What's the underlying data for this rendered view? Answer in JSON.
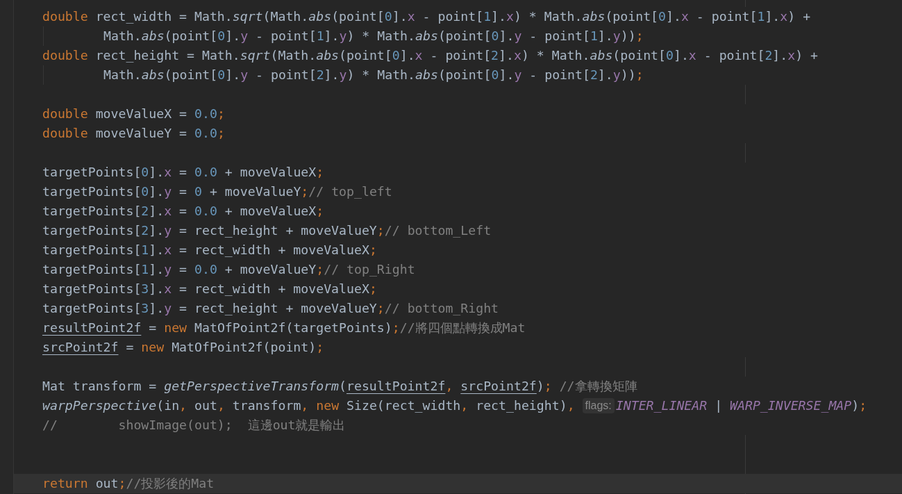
{
  "editor": {
    "lines": [
      {
        "kind": "code",
        "current": false,
        "tokens": [
          {
            "kind": "kw",
            "text": "double"
          },
          {
            "kind": "id",
            "text": " rect_width = Math."
          },
          {
            "kind": "fn",
            "text": "sqrt"
          },
          {
            "kind": "id",
            "text": "(Math."
          },
          {
            "kind": "fn",
            "text": "abs"
          },
          {
            "kind": "id",
            "text": "(point["
          },
          {
            "kind": "num",
            "text": "0"
          },
          {
            "kind": "id",
            "text": "]."
          },
          {
            "kind": "field",
            "text": "x"
          },
          {
            "kind": "id",
            "text": " - point["
          },
          {
            "kind": "num",
            "text": "1"
          },
          {
            "kind": "id",
            "text": "]."
          },
          {
            "kind": "field",
            "text": "x"
          },
          {
            "kind": "id",
            "text": ") * Math."
          },
          {
            "kind": "fn",
            "text": "abs"
          },
          {
            "kind": "id",
            "text": "(point["
          },
          {
            "kind": "num",
            "text": "0"
          },
          {
            "kind": "id",
            "text": "]."
          },
          {
            "kind": "field",
            "text": "x"
          },
          {
            "kind": "id",
            "text": " - point["
          },
          {
            "kind": "num",
            "text": "1"
          },
          {
            "kind": "id",
            "text": "]."
          },
          {
            "kind": "field",
            "text": "x"
          },
          {
            "kind": "id",
            "text": ") +"
          }
        ]
      },
      {
        "kind": "continuation",
        "current": false,
        "tokens": [
          {
            "kind": "id",
            "text": "Math."
          },
          {
            "kind": "fn",
            "text": "abs"
          },
          {
            "kind": "id",
            "text": "(point["
          },
          {
            "kind": "num",
            "text": "0"
          },
          {
            "kind": "id",
            "text": "]."
          },
          {
            "kind": "field",
            "text": "y"
          },
          {
            "kind": "id",
            "text": " - point["
          },
          {
            "kind": "num",
            "text": "1"
          },
          {
            "kind": "id",
            "text": "]."
          },
          {
            "kind": "field",
            "text": "y"
          },
          {
            "kind": "id",
            "text": ") * Math."
          },
          {
            "kind": "fn",
            "text": "abs"
          },
          {
            "kind": "id",
            "text": "(point["
          },
          {
            "kind": "num",
            "text": "0"
          },
          {
            "kind": "id",
            "text": "]."
          },
          {
            "kind": "field",
            "text": "y"
          },
          {
            "kind": "id",
            "text": " - point["
          },
          {
            "kind": "num",
            "text": "1"
          },
          {
            "kind": "id",
            "text": "]."
          },
          {
            "kind": "field",
            "text": "y"
          },
          {
            "kind": "id",
            "text": "))"
          },
          {
            "kind": "punct",
            "text": ";"
          }
        ]
      },
      {
        "kind": "code",
        "current": false,
        "tokens": [
          {
            "kind": "kw",
            "text": "double"
          },
          {
            "kind": "id",
            "text": " rect_height = Math."
          },
          {
            "kind": "fn",
            "text": "sqrt"
          },
          {
            "kind": "id",
            "text": "(Math."
          },
          {
            "kind": "fn",
            "text": "abs"
          },
          {
            "kind": "id",
            "text": "(point["
          },
          {
            "kind": "num",
            "text": "0"
          },
          {
            "kind": "id",
            "text": "]."
          },
          {
            "kind": "field",
            "text": "x"
          },
          {
            "kind": "id",
            "text": " - point["
          },
          {
            "kind": "num",
            "text": "2"
          },
          {
            "kind": "id",
            "text": "]."
          },
          {
            "kind": "field",
            "text": "x"
          },
          {
            "kind": "id",
            "text": ") * Math."
          },
          {
            "kind": "fn",
            "text": "abs"
          },
          {
            "kind": "id",
            "text": "(point["
          },
          {
            "kind": "num",
            "text": "0"
          },
          {
            "kind": "id",
            "text": "]."
          },
          {
            "kind": "field",
            "text": "x"
          },
          {
            "kind": "id",
            "text": " - point["
          },
          {
            "kind": "num",
            "text": "2"
          },
          {
            "kind": "id",
            "text": "]."
          },
          {
            "kind": "field",
            "text": "x"
          },
          {
            "kind": "id",
            "text": ") +"
          }
        ]
      },
      {
        "kind": "continuation",
        "current": false,
        "tokens": [
          {
            "kind": "id",
            "text": "Math."
          },
          {
            "kind": "fn",
            "text": "abs"
          },
          {
            "kind": "id",
            "text": "(point["
          },
          {
            "kind": "num",
            "text": "0"
          },
          {
            "kind": "id",
            "text": "]."
          },
          {
            "kind": "field",
            "text": "y"
          },
          {
            "kind": "id",
            "text": " - point["
          },
          {
            "kind": "num",
            "text": "2"
          },
          {
            "kind": "id",
            "text": "]."
          },
          {
            "kind": "field",
            "text": "y"
          },
          {
            "kind": "id",
            "text": ") * Math."
          },
          {
            "kind": "fn",
            "text": "abs"
          },
          {
            "kind": "id",
            "text": "(point["
          },
          {
            "kind": "num",
            "text": "0"
          },
          {
            "kind": "id",
            "text": "]."
          },
          {
            "kind": "field",
            "text": "y"
          },
          {
            "kind": "id",
            "text": " - point["
          },
          {
            "kind": "num",
            "text": "2"
          },
          {
            "kind": "id",
            "text": "]."
          },
          {
            "kind": "field",
            "text": "y"
          },
          {
            "kind": "id",
            "text": "))"
          },
          {
            "kind": "punct",
            "text": ";"
          }
        ]
      },
      {
        "kind": "blank",
        "current": false
      },
      {
        "kind": "code",
        "current": false,
        "tokens": [
          {
            "kind": "kw",
            "text": "double"
          },
          {
            "kind": "id",
            "text": " moveValueX = "
          },
          {
            "kind": "num",
            "text": "0.0"
          },
          {
            "kind": "punct",
            "text": ";"
          }
        ]
      },
      {
        "kind": "code",
        "current": false,
        "tokens": [
          {
            "kind": "kw",
            "text": "double"
          },
          {
            "kind": "id",
            "text": " moveValueY = "
          },
          {
            "kind": "num",
            "text": "0.0"
          },
          {
            "kind": "punct",
            "text": ";"
          }
        ]
      },
      {
        "kind": "blank",
        "current": false
      },
      {
        "kind": "code",
        "current": false,
        "tokens": [
          {
            "kind": "id",
            "text": "targetPoints["
          },
          {
            "kind": "num",
            "text": "0"
          },
          {
            "kind": "id",
            "text": "]."
          },
          {
            "kind": "field",
            "text": "x"
          },
          {
            "kind": "id",
            "text": " = "
          },
          {
            "kind": "num",
            "text": "0.0"
          },
          {
            "kind": "id",
            "text": " + moveValueX"
          },
          {
            "kind": "punct",
            "text": ";"
          }
        ]
      },
      {
        "kind": "code",
        "current": false,
        "tokens": [
          {
            "kind": "id",
            "text": "targetPoints["
          },
          {
            "kind": "num",
            "text": "0"
          },
          {
            "kind": "id",
            "text": "]."
          },
          {
            "kind": "field",
            "text": "y"
          },
          {
            "kind": "id",
            "text": " = "
          },
          {
            "kind": "num",
            "text": "0"
          },
          {
            "kind": "id",
            "text": " + moveValueY"
          },
          {
            "kind": "punct",
            "text": ";"
          },
          {
            "kind": "com",
            "text": "// top_left"
          }
        ]
      },
      {
        "kind": "code",
        "current": false,
        "tokens": [
          {
            "kind": "id",
            "text": "targetPoints["
          },
          {
            "kind": "num",
            "text": "2"
          },
          {
            "kind": "id",
            "text": "]."
          },
          {
            "kind": "field",
            "text": "x"
          },
          {
            "kind": "id",
            "text": " = "
          },
          {
            "kind": "num",
            "text": "0.0"
          },
          {
            "kind": "id",
            "text": " + moveValueX"
          },
          {
            "kind": "punct",
            "text": ";"
          }
        ]
      },
      {
        "kind": "code",
        "current": false,
        "tokens": [
          {
            "kind": "id",
            "text": "targetPoints["
          },
          {
            "kind": "num",
            "text": "2"
          },
          {
            "kind": "id",
            "text": "]."
          },
          {
            "kind": "field",
            "text": "y"
          },
          {
            "kind": "id",
            "text": " = rect_height + moveValueY"
          },
          {
            "kind": "punct",
            "text": ";"
          },
          {
            "kind": "com",
            "text": "// bottom_Left"
          }
        ]
      },
      {
        "kind": "code",
        "current": false,
        "tokens": [
          {
            "kind": "id",
            "text": "targetPoints["
          },
          {
            "kind": "num",
            "text": "1"
          },
          {
            "kind": "id",
            "text": "]."
          },
          {
            "kind": "field",
            "text": "x"
          },
          {
            "kind": "id",
            "text": " = rect_width + moveValueX"
          },
          {
            "kind": "punct",
            "text": ";"
          }
        ]
      },
      {
        "kind": "code",
        "current": false,
        "tokens": [
          {
            "kind": "id",
            "text": "targetPoints["
          },
          {
            "kind": "num",
            "text": "1"
          },
          {
            "kind": "id",
            "text": "]."
          },
          {
            "kind": "field",
            "text": "y"
          },
          {
            "kind": "id",
            "text": " = "
          },
          {
            "kind": "num",
            "text": "0.0"
          },
          {
            "kind": "id",
            "text": " + moveValueY"
          },
          {
            "kind": "punct",
            "text": ";"
          },
          {
            "kind": "com",
            "text": "// top_Right"
          }
        ]
      },
      {
        "kind": "code",
        "current": false,
        "tokens": [
          {
            "kind": "id",
            "text": "targetPoints["
          },
          {
            "kind": "num",
            "text": "3"
          },
          {
            "kind": "id",
            "text": "]."
          },
          {
            "kind": "field",
            "text": "x"
          },
          {
            "kind": "id",
            "text": " = rect_width + moveValueX"
          },
          {
            "kind": "punct",
            "text": ";"
          }
        ]
      },
      {
        "kind": "code",
        "current": false,
        "tokens": [
          {
            "kind": "id",
            "text": "targetPoints["
          },
          {
            "kind": "num",
            "text": "3"
          },
          {
            "kind": "id",
            "text": "]."
          },
          {
            "kind": "field",
            "text": "y"
          },
          {
            "kind": "id",
            "text": " = rect_height + moveValueY"
          },
          {
            "kind": "punct",
            "text": ";"
          },
          {
            "kind": "com",
            "text": "// bottom_Right"
          }
        ]
      },
      {
        "kind": "code",
        "current": false,
        "tokens": [
          {
            "kind": "ul",
            "text": "resultPoint2f"
          },
          {
            "kind": "id",
            "text": " = "
          },
          {
            "kind": "kw",
            "text": "new"
          },
          {
            "kind": "id",
            "text": " MatOfPoint2f(targetPoints)"
          },
          {
            "kind": "punct",
            "text": ";"
          },
          {
            "kind": "com",
            "text": "//將四個點轉換成Mat"
          }
        ]
      },
      {
        "kind": "code",
        "current": false,
        "tokens": [
          {
            "kind": "ul",
            "text": "srcPoint2f"
          },
          {
            "kind": "id",
            "text": " = "
          },
          {
            "kind": "kw",
            "text": "new"
          },
          {
            "kind": "id",
            "text": " MatOfPoint2f(point)"
          },
          {
            "kind": "punct",
            "text": ";"
          }
        ]
      },
      {
        "kind": "blank",
        "current": false
      },
      {
        "kind": "code",
        "current": false,
        "tokens": [
          {
            "kind": "id",
            "text": "Mat transform = "
          },
          {
            "kind": "fn",
            "text": "getPerspectiveTransform"
          },
          {
            "kind": "id",
            "text": "("
          },
          {
            "kind": "ul",
            "text": "resultPoint2f"
          },
          {
            "kind": "punct",
            "text": ", "
          },
          {
            "kind": "ul",
            "text": "srcPoint2f"
          },
          {
            "kind": "id",
            "text": ")"
          },
          {
            "kind": "punct",
            "text": "; "
          },
          {
            "kind": "com",
            "text": "//拿轉換矩陣"
          }
        ]
      },
      {
        "kind": "code",
        "current": false,
        "tokens": [
          {
            "kind": "fn",
            "text": "warpPerspective"
          },
          {
            "kind": "id",
            "text": "(in"
          },
          {
            "kind": "punct",
            "text": ", "
          },
          {
            "kind": "id",
            "text": "out"
          },
          {
            "kind": "punct",
            "text": ", "
          },
          {
            "kind": "id",
            "text": "transform"
          },
          {
            "kind": "punct",
            "text": ", "
          },
          {
            "kind": "kw",
            "text": "new"
          },
          {
            "kind": "id",
            "text": " Size(rect_width"
          },
          {
            "kind": "punct",
            "text": ", "
          },
          {
            "kind": "id",
            "text": "rect_height)"
          },
          {
            "kind": "punct",
            "text": ", "
          },
          {
            "kind": "hint",
            "text": "flags:"
          },
          {
            "kind": "const",
            "text": "INTER_LINEAR"
          },
          {
            "kind": "id",
            "text": " | "
          },
          {
            "kind": "const",
            "text": "WARP_INVERSE_MAP"
          },
          {
            "kind": "id",
            "text": ")"
          },
          {
            "kind": "punct",
            "text": ";"
          }
        ]
      },
      {
        "kind": "code",
        "current": false,
        "tokens": [
          {
            "kind": "com",
            "text": "//        showImage(out);  這邊out就是輸出"
          }
        ]
      },
      {
        "kind": "blank",
        "current": false
      },
      {
        "kind": "blank",
        "current": false
      },
      {
        "kind": "code",
        "current": true,
        "tokens": [
          {
            "kind": "kw",
            "text": "return"
          },
          {
            "kind": "id",
            "text": " out"
          },
          {
            "kind": "punct",
            "text": ";"
          },
          {
            "kind": "com",
            "text": "//投影後的Mat"
          }
        ]
      }
    ]
  }
}
